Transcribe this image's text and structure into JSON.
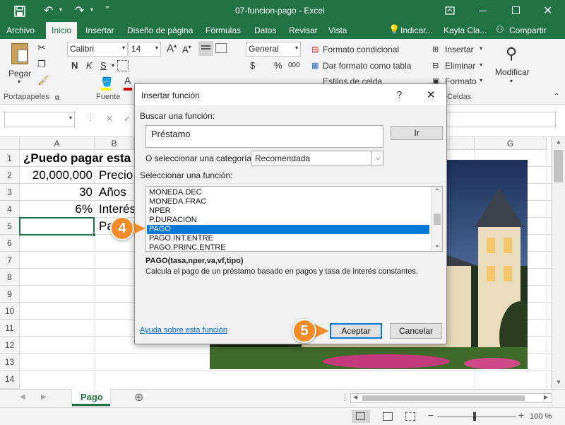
{
  "window": {
    "title": "07-funcion-pago  -  Excel"
  },
  "tabs": [
    "Archivo",
    "Inicio",
    "Insertar",
    "Diseño de página",
    "Fórmulas",
    "Datos",
    "Revisar",
    "Vista"
  ],
  "tell_me": "Indicar...",
  "user": "Kayla Cla...",
  "share": "Compartir",
  "ribbon": {
    "paste": "Pegar",
    "clipboard_group": "Portapapeles",
    "font_name": "Calibri",
    "font_size": "14",
    "font_group": "Fuente",
    "bold": "N",
    "italic": "K",
    "underline": "S",
    "number_format": "General",
    "currency": "$",
    "percent": "%",
    "thousands": "000",
    "conditional_format": "Formato condicional",
    "table_format": "Dar formato como tabla",
    "cell_styles": "Estilos de celda",
    "insert": "Insertar",
    "delete": "Eliminar",
    "format": "Formato",
    "cells_group": "Celdas",
    "modify": "Modificar"
  },
  "columns": [
    "A",
    "B",
    "G"
  ],
  "rows": [
    "1",
    "2",
    "3",
    "4",
    "5",
    "6",
    "7",
    "8",
    "9",
    "10",
    "11",
    "12",
    "13",
    "14"
  ],
  "cells": {
    "b1": "¿Puedo pagar esta c",
    "a2": "20,000,000",
    "b2": "Precio",
    "a3": "30",
    "b3": "Años",
    "a4": "6%",
    "b4": "Interés",
    "b5": "Pa"
  },
  "sheet_tab": "Pago",
  "zoom": "100 %",
  "dialog": {
    "title": "Insertar función",
    "help": "?",
    "search_label": "Buscar una función:",
    "search_value": "Préstamo",
    "go": "Ir",
    "category_label": "O seleccionar una categoría:",
    "category_value": "Recomendada",
    "select_label": "Seleccionar una función:",
    "functions": [
      "MONEDA.DEC",
      "MONEDA.FRAC",
      "NPER",
      "P.DURACION",
      "PAGO",
      "PAGO.INT.ENTRE",
      "PAGO.PRINC.ENTRE"
    ],
    "selected_index": 4,
    "signature": "PAGO(tasa,nper,va,vf,tipo)",
    "description": "Calcula el pago de un préstamo basado en pagos y tasa de interés constantes.",
    "help_link": "Ayuda sobre esta función",
    "ok": "Aceptar",
    "cancel": "Cancelar"
  },
  "callouts": {
    "step4": "4",
    "step5": "5"
  },
  "colors": {
    "excel_green": "#217346",
    "accent_orange": "#f28c28",
    "selection_blue": "#0078d7"
  }
}
